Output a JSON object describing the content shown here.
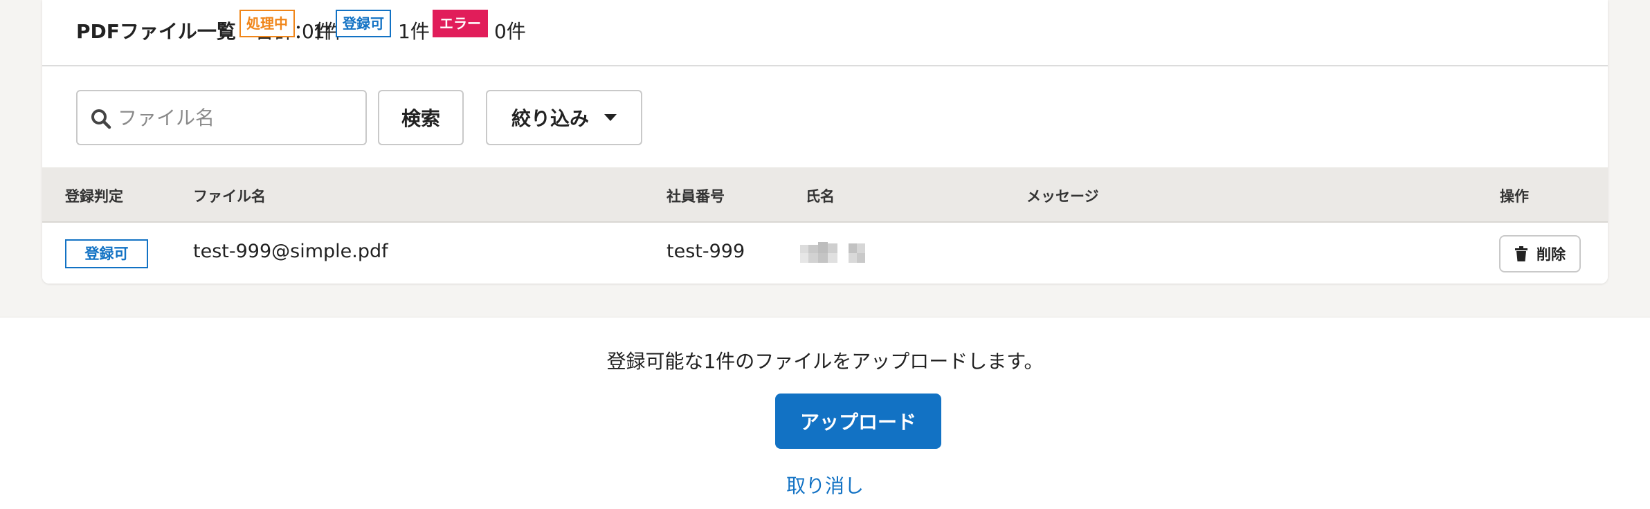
{
  "summary": {
    "title": "PDFファイル一覧",
    "total": "合計：1件",
    "processing_label": "処理中",
    "processing_count": "0件",
    "ok_label": "登録可",
    "ok_count": "1件",
    "error_label": "エラー",
    "error_count": "0件"
  },
  "toolbar": {
    "search_placeholder": "ファイル名",
    "search_value": "",
    "search_button": "検索",
    "filter_button": "絞り込み"
  },
  "table": {
    "columns": [
      "登録判定",
      "ファイル名",
      "社員番号",
      "氏名",
      "メッセージ",
      "操作"
    ],
    "rows": [
      {
        "status": "登録可",
        "file_name": "test-999@simple.pdf",
        "employee_no": "test-999",
        "name": "",
        "message": "",
        "delete_label": "削除"
      }
    ]
  },
  "footer": {
    "message": "登録可能な1件のファイルをアップロードします。",
    "upload_button": "アップロード",
    "cancel_link": "取り消し"
  },
  "colors": {
    "accent": "#1272c4",
    "processing": "#f0861a",
    "error": "#e11d5a",
    "table_header_bg": "#ebe9e6",
    "page_bg": "#f5f4f2"
  },
  "icons": {
    "search": "search-icon",
    "filter_caret": "caret-down-icon",
    "delete": "trash-icon"
  }
}
